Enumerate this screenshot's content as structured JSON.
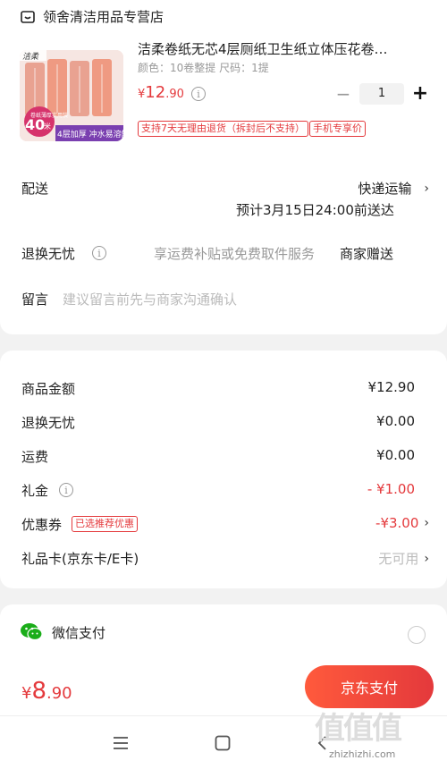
{
  "store": {
    "name": "领舍清洁用品专营店",
    "icon": "store-icon"
  },
  "product": {
    "title": "洁柔卷纸无芯4层厕纸卫生纸立体压花卷…",
    "spec": "颜色：10卷整提   尺码：1提",
    "price_symbol": "¥",
    "price_int": "12",
    "price_dec": ".90",
    "qty": "1",
    "image": {
      "brand": "洁柔",
      "badge_top": "卷纸薄厚实用装",
      "badge_num": "40",
      "badge_unit": "米",
      "banner": "4层加厚 冲水易溶解"
    },
    "tags": [
      "支持7天无理由退货（拆封后不支持）",
      "手机专享价"
    ]
  },
  "delivery": {
    "label": "配送",
    "method": "快递运输",
    "eta": "预计3月15日24:00前送达"
  },
  "returns": {
    "label": "退换无忧",
    "desc": "享运费补贴或免费取件服务",
    "value": "商家赠送"
  },
  "note": {
    "label": "留言",
    "placeholder": "建议留言前先与商家沟通确认"
  },
  "summary": [
    {
      "label": "商品金额",
      "value": "¥12.90"
    },
    {
      "label": "退换无忧",
      "value": "¥0.00"
    },
    {
      "label": "运费",
      "value": "¥0.00"
    },
    {
      "label": "礼金",
      "value": "- ¥1.00"
    },
    {
      "label": "优惠券",
      "badge": "已选推荐优惠",
      "value": "-¥3.00"
    },
    {
      "label": "礼品卡(京东卡/E卡)",
      "value": "无可用"
    }
  ],
  "payment": {
    "method": "微信支付"
  },
  "footer": {
    "total_symbol": "¥",
    "total_int": "8",
    "total_dec": ".90",
    "pay_button": "京东支付"
  },
  "watermark": {
    "logo": "值",
    "text": "zhizhizhi.com"
  },
  "colors": {
    "accent": "#e4393c",
    "wechat": "#1aad19"
  }
}
